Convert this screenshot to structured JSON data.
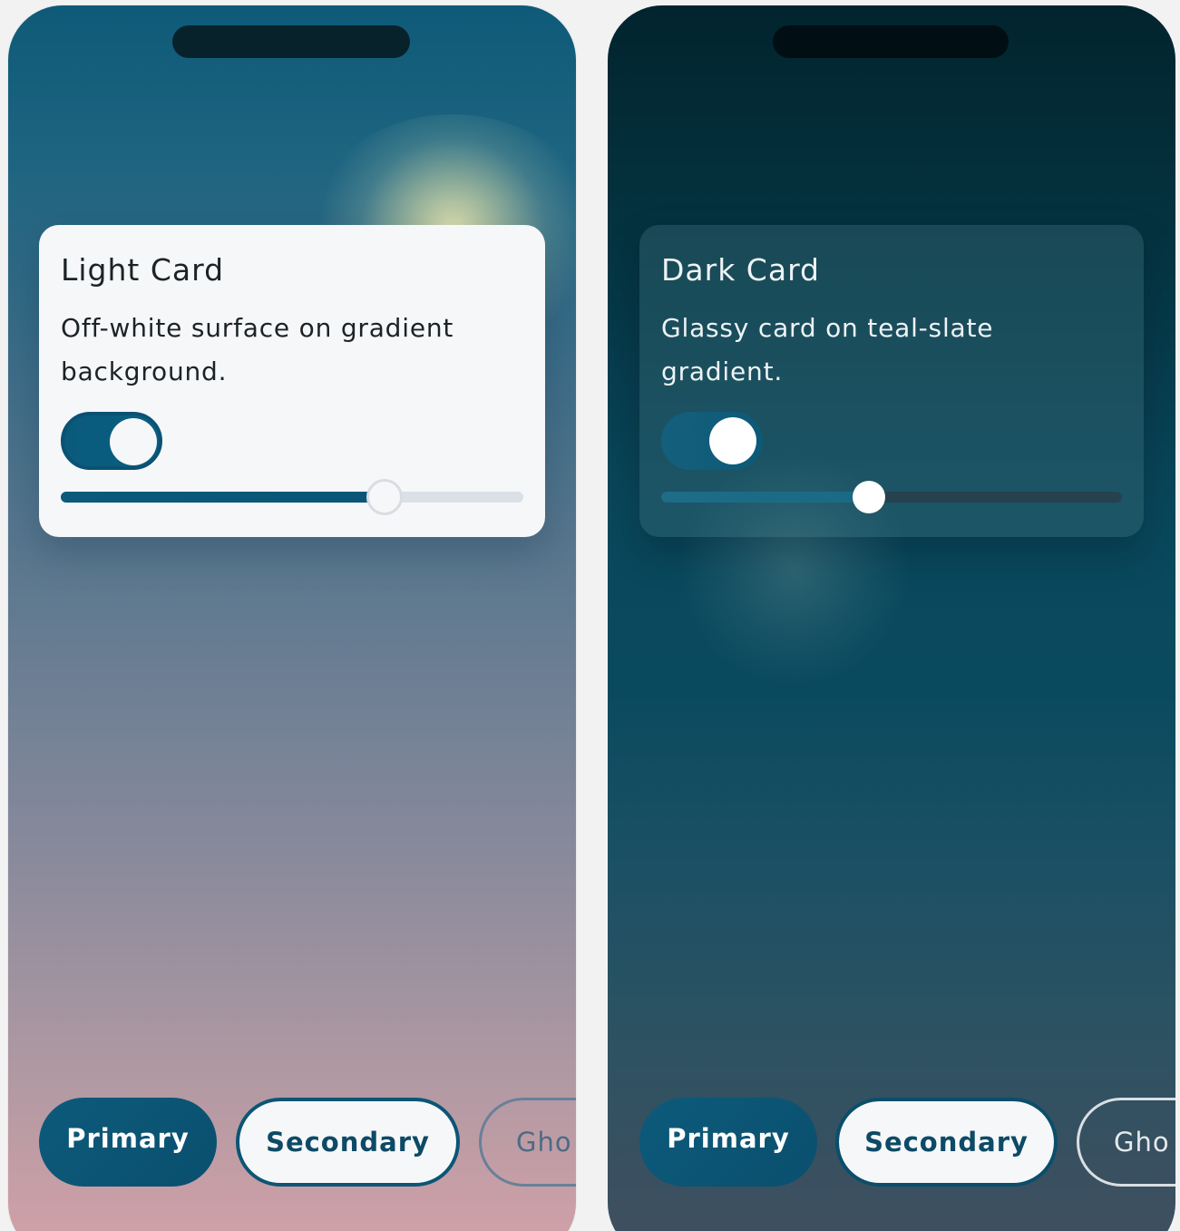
{
  "light_phone": {
    "card": {
      "title": "Light Card",
      "body": "Off-white surface on gradient background.",
      "toggle_on": true,
      "slider_value": 0.7
    },
    "buttons": {
      "primary": "Primary",
      "secondary": "Secondary",
      "ghost": "Gho"
    }
  },
  "dark_phone": {
    "card": {
      "title": "Dark Card",
      "body": "Glassy card on teal-slate gradient.",
      "toggle_on": true,
      "slider_value": 0.45
    },
    "buttons": {
      "primary": "Primary",
      "secondary": "Secondary",
      "ghost": "Gho"
    }
  },
  "colors": {
    "accent": "#0b5a7b",
    "surface_light": "#f6f7f9",
    "text_dark": "#1c2327"
  }
}
